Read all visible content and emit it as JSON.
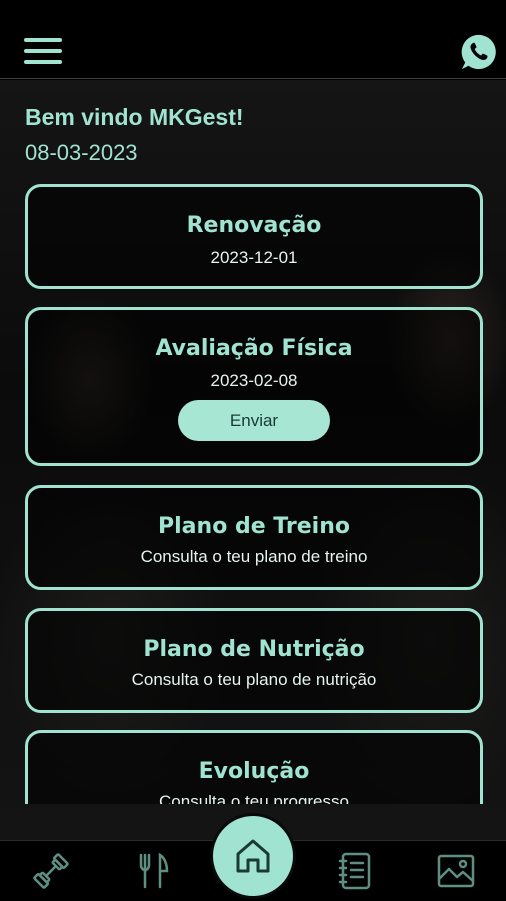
{
  "header": {
    "menu_icon": "hamburger-menu-icon",
    "whatsapp_icon": "whatsapp-icon"
  },
  "welcome": {
    "greeting": "Bem vindo MKGest!",
    "date": "08-03-2023"
  },
  "cards": {
    "renewal": {
      "title": "Renovação",
      "subtitle": "2023-12-01"
    },
    "assessment": {
      "title": "Avaliação Física",
      "subtitle": "2023-02-08",
      "button_label": "Enviar"
    },
    "training": {
      "title": "Plano de Treino",
      "subtitle": "Consulta o teu plano de treino"
    },
    "nutrition": {
      "title": "Plano de Nutrição",
      "subtitle": "Consulta o teu plano de nutrição"
    },
    "evolution": {
      "title": "Evolução",
      "subtitle": "Consulta o teu progresso"
    }
  },
  "bottom_nav": {
    "items": [
      "dumbbell-icon",
      "fork-knife-icon",
      "home-icon",
      "notebook-icon",
      "gallery-icon"
    ],
    "active": "home-icon"
  },
  "colors": {
    "accent": "#9fe3d0",
    "background": "#000000",
    "button_fill": "#a8e6d4"
  }
}
